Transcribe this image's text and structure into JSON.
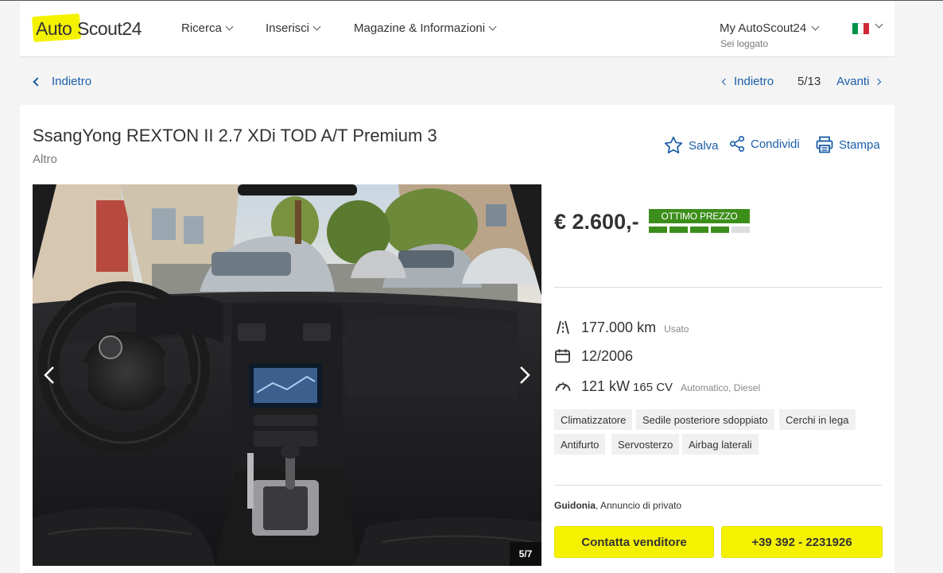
{
  "header": {
    "logo_auto": "Auto",
    "logo_scout": "Scout24",
    "nav": [
      "Ricerca",
      "Inserisci",
      "Magazine & Informazioni"
    ],
    "account_label": "My AutoScout24",
    "account_status": "Sei loggato",
    "flag_colors": [
      "#009246",
      "#ffffff",
      "#ce2b37"
    ]
  },
  "navigation": {
    "back_label": "Indietro",
    "prev_label": "Indietro",
    "pager": "5/13",
    "next_label": "Avanti"
  },
  "listing": {
    "title": "SsangYong REXTON II 2.7 XDi TOD A/T Premium 3",
    "subtitle": "Altro",
    "actions": {
      "save": "Salva",
      "share": "Condividi",
      "print": "Stampa"
    },
    "gallery": {
      "counter": "5/7"
    },
    "price": "€ 2.600,-",
    "price_badge": "OTTIMO PREZZO",
    "price_rating_filled": 4,
    "price_rating_total": 5,
    "mileage": "177.000 km",
    "condition": "Usato",
    "registration": "12/2006",
    "power_kw": "121 kW",
    "power_cv": "165 CV",
    "transmission_fuel": "Automatico, Diesel",
    "features": [
      "Climatizzatore",
      "Sedile posteriore sdoppiato",
      "Cerchi in lega",
      "Antifurto",
      "Servosterzo",
      "Airbag laterali"
    ],
    "seller_location": "Guidonia",
    "seller_type": ", Annuncio di privato",
    "contact_button": "Contatta venditore",
    "phone_button": "+39 392 - 2231926"
  },
  "colors": {
    "brand_yellow": "#f5f200",
    "link_blue": "#1a5ea8",
    "price_green": "#3c8e1b"
  }
}
